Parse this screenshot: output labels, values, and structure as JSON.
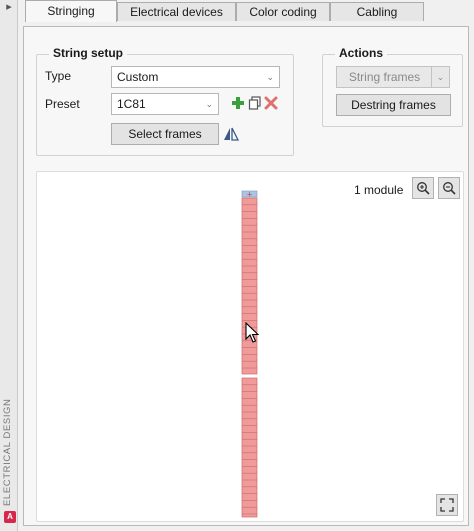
{
  "side_panel": {
    "label": "ELECTRICAL DESIGN",
    "badge": "A"
  },
  "tabs": [
    {
      "label": "Stringing",
      "active": true
    },
    {
      "label": "Electrical devices",
      "active": false
    },
    {
      "label": "Color coding",
      "active": false
    },
    {
      "label": "Cabling",
      "active": false
    }
  ],
  "string_setup": {
    "title": "String setup",
    "type_label": "Type",
    "type_value": "Custom",
    "preset_label": "Preset",
    "preset_value": "1C81",
    "select_frames_label": "Select frames",
    "add_icon": "plus-icon",
    "copy_icon": "copy-icon",
    "delete_icon": "x-icon",
    "mirror_icon": "mirror-icon"
  },
  "actions": {
    "title": "Actions",
    "string_frames_label": "String frames",
    "destring_frames_label": "Destring frames"
  },
  "view": {
    "module_count": "1 module",
    "zoom_in_icon": "zoom-in-icon",
    "zoom_out_icon": "zoom-out-icon",
    "fullscreen_icon": "fullscreen-icon",
    "module_fill_color": "#f19a9a",
    "module_line_color": "#c96a6a",
    "header_cell_color": "#aac4e4"
  }
}
